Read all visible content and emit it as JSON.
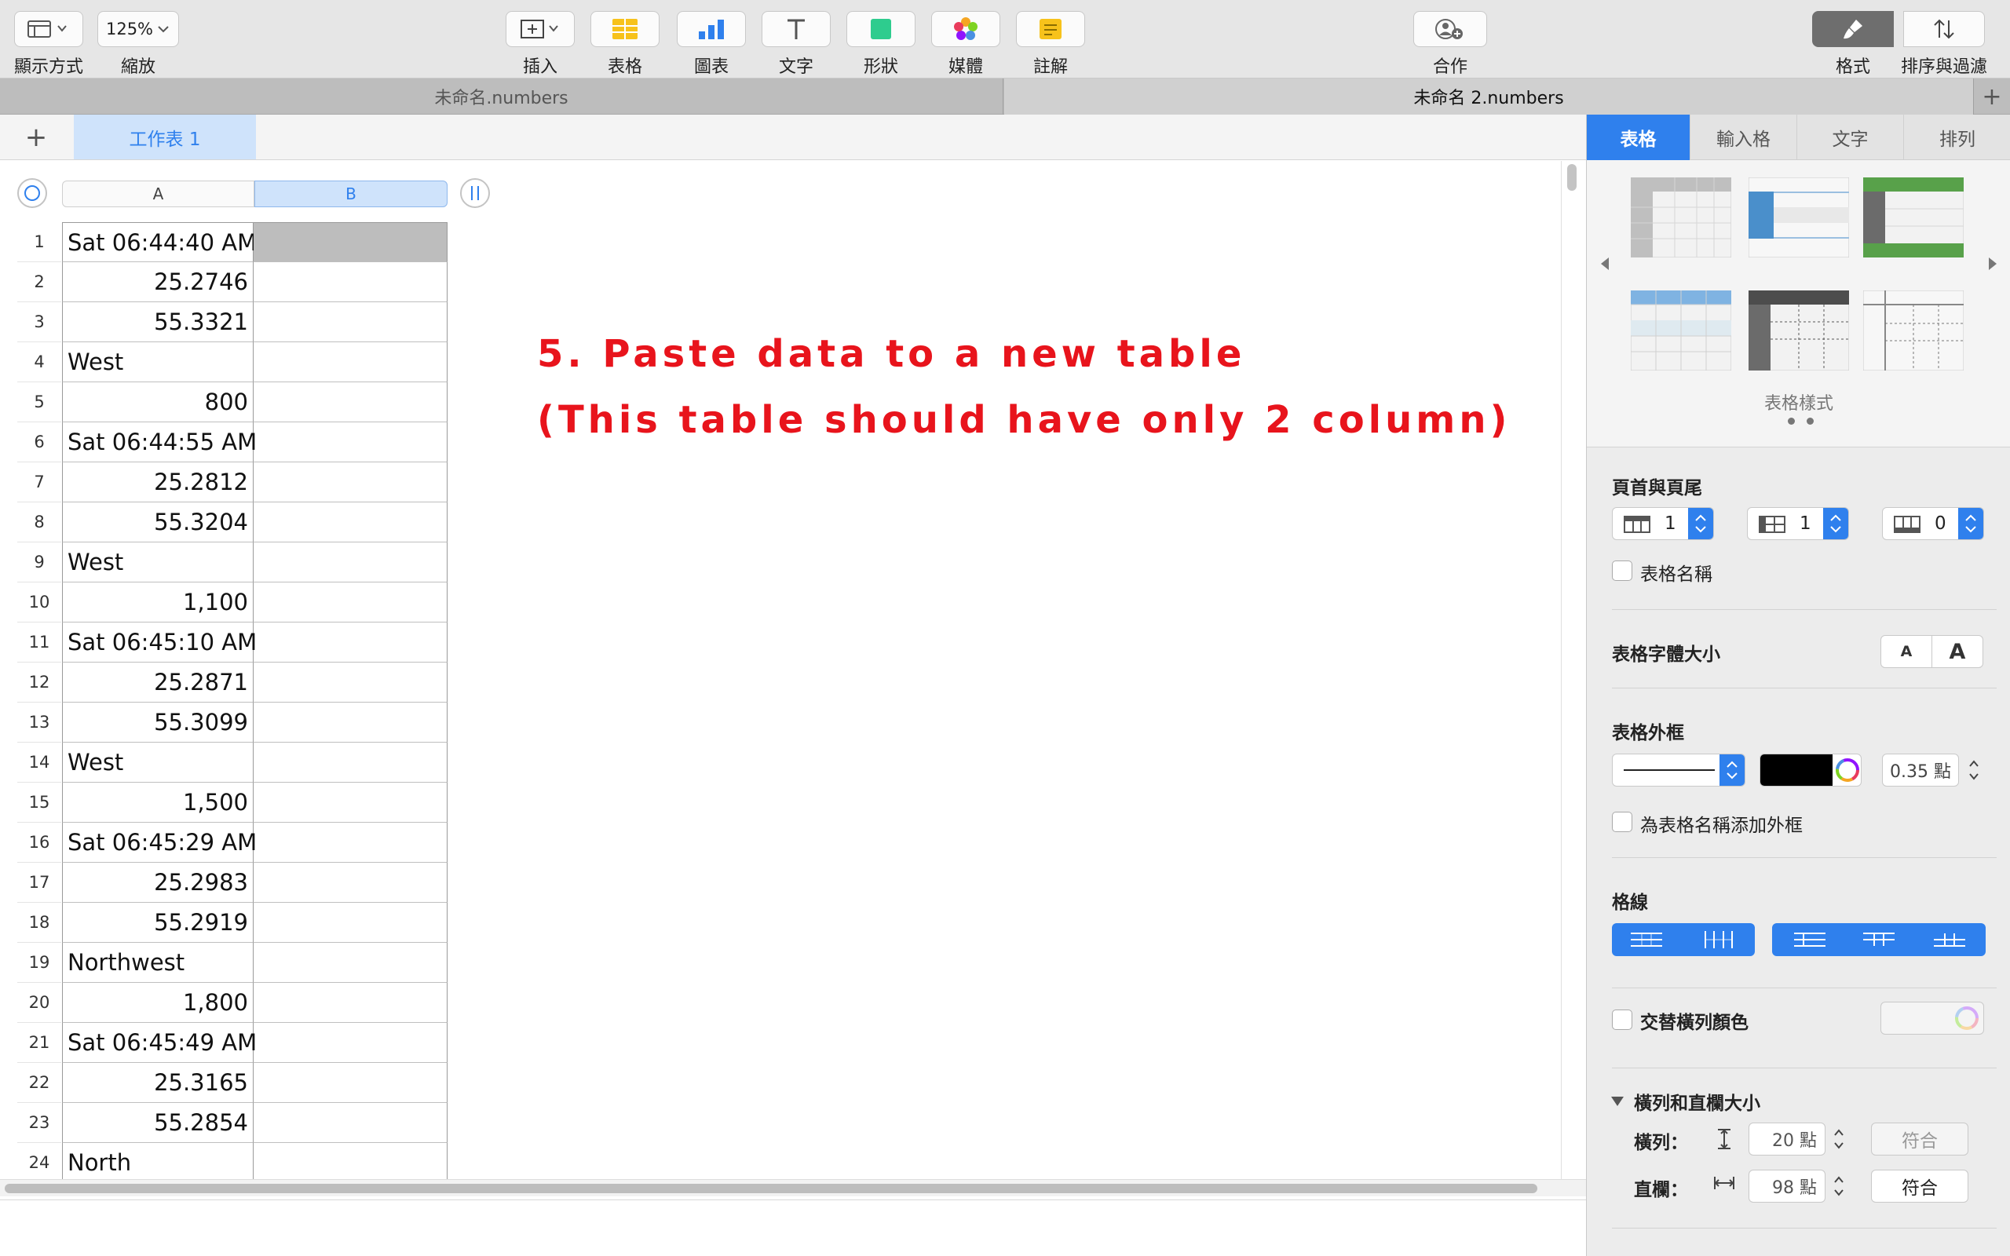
{
  "toolbar": {
    "view": {
      "label": "顯示方式",
      "icon": "sidebar-layout-icon"
    },
    "zoom": {
      "label": "縮放",
      "value": "125%"
    },
    "insert": {
      "label": "插入",
      "icon": "insert-icon"
    },
    "table": {
      "label": "表格",
      "icon": "table-icon"
    },
    "chart": {
      "label": "圖表",
      "icon": "chart-icon"
    },
    "text": {
      "label": "文字",
      "icon": "text-icon"
    },
    "shape": {
      "label": "形狀",
      "icon": "shape-icon"
    },
    "media": {
      "label": "媒體",
      "icon": "media-icon"
    },
    "comment": {
      "label": "註解",
      "icon": "comment-icon"
    },
    "collaborate": {
      "label": "合作",
      "icon": "collaborate-icon"
    },
    "format": {
      "label": "格式",
      "icon": "paintbrush-icon"
    },
    "sort": {
      "label": "排序與過濾",
      "icon": "sort-icon"
    }
  },
  "doc_tabs": [
    "未命名.numbers",
    "未命名 2.numbers"
  ],
  "sheet_tabs": [
    {
      "label": "工作表 1",
      "active": true
    }
  ],
  "columns": [
    "A",
    "B"
  ],
  "rows": [
    {
      "n": "1",
      "a": "Sat 06:44:40 AM",
      "align": "left"
    },
    {
      "n": "2",
      "a": "25.2746",
      "align": "right"
    },
    {
      "n": "3",
      "a": "55.3321",
      "align": "right"
    },
    {
      "n": "4",
      "a": "West",
      "align": "left"
    },
    {
      "n": "5",
      "a": "800",
      "align": "right"
    },
    {
      "n": "6",
      "a": "Sat 06:44:55 AM",
      "align": "left"
    },
    {
      "n": "7",
      "a": "25.2812",
      "align": "right"
    },
    {
      "n": "8",
      "a": "55.3204",
      "align": "right"
    },
    {
      "n": "9",
      "a": "West",
      "align": "left"
    },
    {
      "n": "10",
      "a": "1,100",
      "align": "right"
    },
    {
      "n": "11",
      "a": "Sat 06:45:10 AM",
      "align": "left"
    },
    {
      "n": "12",
      "a": "25.2871",
      "align": "right"
    },
    {
      "n": "13",
      "a": "55.3099",
      "align": "right"
    },
    {
      "n": "14",
      "a": "West",
      "align": "left"
    },
    {
      "n": "15",
      "a": "1,500",
      "align": "right"
    },
    {
      "n": "16",
      "a": "Sat 06:45:29 AM",
      "align": "left"
    },
    {
      "n": "17",
      "a": "25.2983",
      "align": "right"
    },
    {
      "n": "18",
      "a": "55.2919",
      "align": "right"
    },
    {
      "n": "19",
      "a": "Northwest",
      "align": "left"
    },
    {
      "n": "20",
      "a": "1,800",
      "align": "right"
    },
    {
      "n": "21",
      "a": "Sat 06:45:49 AM",
      "align": "left"
    },
    {
      "n": "22",
      "a": "25.3165",
      "align": "right"
    },
    {
      "n": "23",
      "a": "55.2854",
      "align": "right"
    },
    {
      "n": "24",
      "a": "North",
      "align": "left"
    }
  ],
  "annotation": {
    "line1": "5. Paste data to a new table",
    "line2": "(This table should have only 2 column)",
    "color": "#e8141c"
  },
  "inspector": {
    "tabs": [
      "表格",
      "輸入格",
      "文字",
      "排列"
    ],
    "styles_label": "表格樣式",
    "header_footer": {
      "title": "頁首與頁尾",
      "header_rows": "1",
      "header_cols": "1",
      "footer_rows": "0"
    },
    "table_name_label": "表格名稱",
    "font_size": {
      "title": "表格字體大小",
      "small": "A",
      "large": "A"
    },
    "outline": {
      "title": "表格外框",
      "width": "0.35 點",
      "color": "#000000"
    },
    "outline_name_label": "為表格名稱添加外框",
    "gridlines_title": "格線",
    "alternate_label": "交替橫列顏色",
    "row_col": {
      "title": "橫列和直欄大小",
      "row_label": "橫列：",
      "row_value": "20 點",
      "col_label": "直欄：",
      "col_value": "98 點",
      "fit": "符合"
    }
  },
  "accent": "#2f80ed"
}
